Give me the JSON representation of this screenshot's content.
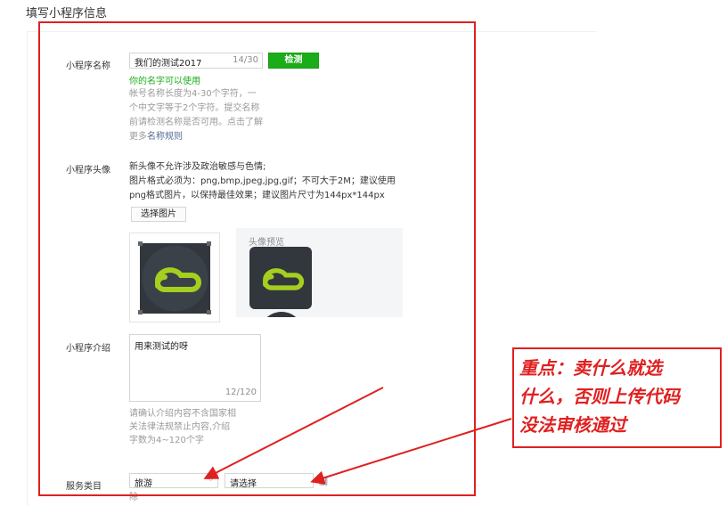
{
  "page": {
    "title": "填写小程序信息"
  },
  "name_section": {
    "label": "小程序名称",
    "input_value": "我们的测试2017",
    "char_count": "14/30",
    "check_button": "检测",
    "available_text": "你的名字可以使用",
    "tip_lines": [
      "帐号名称长度为4-30个字符，一",
      "个中文字等于2个字符。提交名称",
      "前请检测名称是否可用。点击了解"
    ],
    "tip_more_prefix": "更多",
    "tip_link": "名称规则"
  },
  "avatar_section": {
    "label": "小程序头像",
    "desc_lines": [
      "新头像不允许涉及政治敏感与色情;",
      "图片格式必须为：png,bmp,jpeg,jpg,gif；不可大于2M；建议使用",
      "png格式图片，以保持最佳效果；建议图片尺寸为144px*144px"
    ],
    "choose_button": "选择图片",
    "preview_label": "头像预览",
    "logo_color": "#a5cf1f",
    "logo_bg": "#32373d"
  },
  "intro_section": {
    "label": "小程序介绍",
    "input_value": "用来测试的呀",
    "char_count": "12/120",
    "tip_lines": [
      "请确认介绍内容不含国家相",
      "关法律法规禁止内容,介绍",
      "字数为4~120个字"
    ]
  },
  "category_section": {
    "label": "服务类目",
    "primary_value": "旅游",
    "secondary_value": "请选择",
    "delete_label": "删除"
  },
  "annotation": {
    "lines": [
      "重点：卖什么就选",
      "什么，否则上传代码",
      "没法审核通过"
    ],
    "color": "#e02020"
  }
}
